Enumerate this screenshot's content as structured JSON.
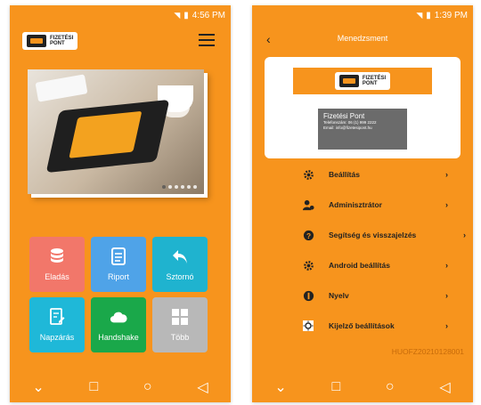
{
  "left_phone": {
    "status": {
      "time": "4:56 PM"
    },
    "logo": {
      "line1": "FIZETÉSI",
      "line2": "PONT"
    },
    "tiles": [
      {
        "label": "Eladás",
        "icon": "database-icon",
        "color": "#f2776a"
      },
      {
        "label": "Riport",
        "icon": "document-icon",
        "color": "#4fa3e8"
      },
      {
        "label": "Sztornó",
        "icon": "undo-arrow-icon",
        "color": "#1fb3cf"
      },
      {
        "label": "Napzárás",
        "icon": "receipt-edit-icon",
        "color": "#1fb8d8"
      },
      {
        "label": "Handshake",
        "icon": "cloud-icon",
        "color": "#1aa84a"
      },
      {
        "label": "Több",
        "icon": "grid-icon",
        "color": "#b8b8b8"
      }
    ]
  },
  "right_phone": {
    "status": {
      "time": "1:39 PM"
    },
    "title": "Menedzsment",
    "logo": {
      "line1": "FIZETÉSI",
      "line2": "PONT"
    },
    "company": {
      "name": "Fizetési Pont",
      "phone": "Telefonszám: 06 (1) 999 2222",
      "email": "Email: info@fizetesipont.hu"
    },
    "menu": [
      {
        "label": "Beállítás",
        "icon": "gear-icon"
      },
      {
        "label": "Adminisztrátor",
        "icon": "admin-user-icon"
      },
      {
        "label": "Segítség és visszajelzés",
        "icon": "help-icon"
      },
      {
        "label": "Android beállítás",
        "icon": "android-gear-icon"
      },
      {
        "label": "Nyelv",
        "icon": "language-icon"
      },
      {
        "label": "Kijelző beállítások",
        "icon": "brightness-icon"
      }
    ],
    "serial": "HUOFZ20210128001"
  }
}
